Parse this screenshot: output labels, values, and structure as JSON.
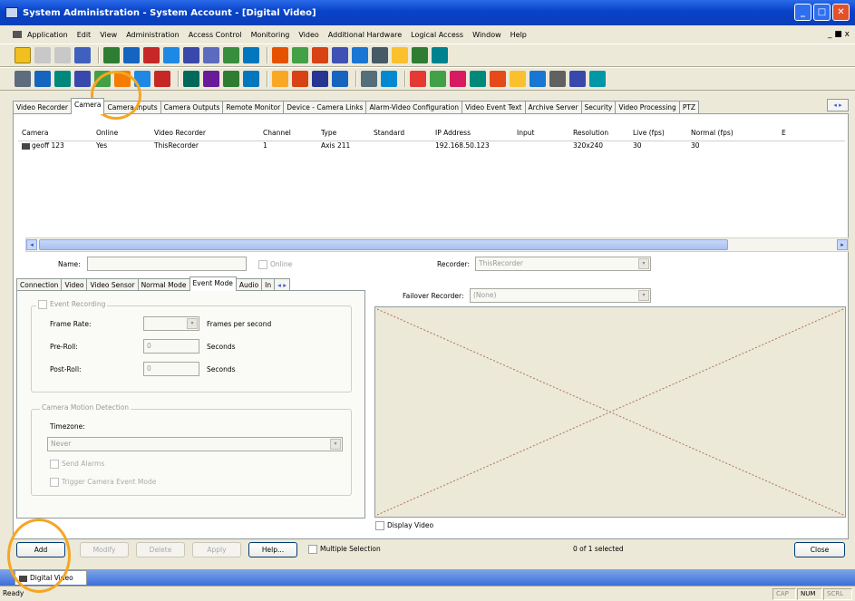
{
  "window": {
    "title": "System Administration - System Account - [Digital Video]",
    "min": "_",
    "max": "□",
    "close": "✕"
  },
  "menu": {
    "items": [
      "Application",
      "Edit",
      "View",
      "Administration",
      "Access Control",
      "Monitoring",
      "Video",
      "Additional Hardware",
      "Logical Access",
      "Window",
      "Help"
    ],
    "right": "_ ■ x"
  },
  "tabs": [
    "Video Recorder",
    "Camera",
    "Camera Inputs",
    "Camera Outputs",
    "Remote Monitor",
    "Device - Camera Links",
    "Alarm-Video Configuration",
    "Video Event Text",
    "Archive Server",
    "Security",
    "Video Processing",
    "PTZ"
  ],
  "tab_scroll": "◂ ▸",
  "grid": {
    "columns": [
      "Camera",
      "Online",
      "Video Recorder",
      "Channel",
      "Type",
      "Standard",
      "IP Address",
      "Input",
      "Resolution",
      "Live (fps)",
      "Normal (fps)",
      "E"
    ],
    "rows": [
      [
        "geoff 123",
        "Yes",
        "ThisRecorder",
        "1",
        "Axis 211",
        "",
        "192.168.50.123",
        "",
        "320x240",
        "30",
        "30",
        ""
      ]
    ]
  },
  "scroll": {
    "left": "◂",
    "right": "▸"
  },
  "form": {
    "name_label": "Name:",
    "name_value": "",
    "online_label": "Online",
    "recorder_label": "Recorder:",
    "recorder_value": "ThisRecorder",
    "failover_label": "Failover Recorder:",
    "failover_value": "(None)",
    "display_video_label": "Display Video",
    "combo_arrow": "▾"
  },
  "subtabs": [
    "Connection",
    "Video",
    "Video Sensor",
    "Normal Mode",
    "Event Mode",
    "Audio",
    "In"
  ],
  "subtab_scroll": "◂ ▸",
  "event_mode": {
    "event_recording_label": "Event Recording",
    "frame_rate_label": "Frame Rate:",
    "frame_rate_unit": "Frames per second",
    "frame_rate_value": "",
    "preroll_label": "Pre-Roll:",
    "preroll_value": "0",
    "preroll_unit": "Seconds",
    "postroll_label": "Post-Roll:",
    "postroll_value": "0",
    "postroll_unit": "Seconds",
    "motion_group_title": "Camera Motion Detection",
    "timezone_label": "Timezone:",
    "timezone_value": "Never",
    "send_alarms_label": "Send Alarms",
    "trigger_label": "Trigger Camera Event Mode"
  },
  "buttons": {
    "add": "Add",
    "modify": "Modify",
    "delete": "Delete",
    "apply": "Apply",
    "help": "Help...",
    "multiple_selection": "Multiple Selection",
    "close": "Close"
  },
  "selection_status": "0 of 1 selected",
  "doc_tab": "Digital Video",
  "status": {
    "ready": "Ready",
    "num": "NUM",
    "panel1": "CAP",
    "panel3": "SCRL"
  }
}
